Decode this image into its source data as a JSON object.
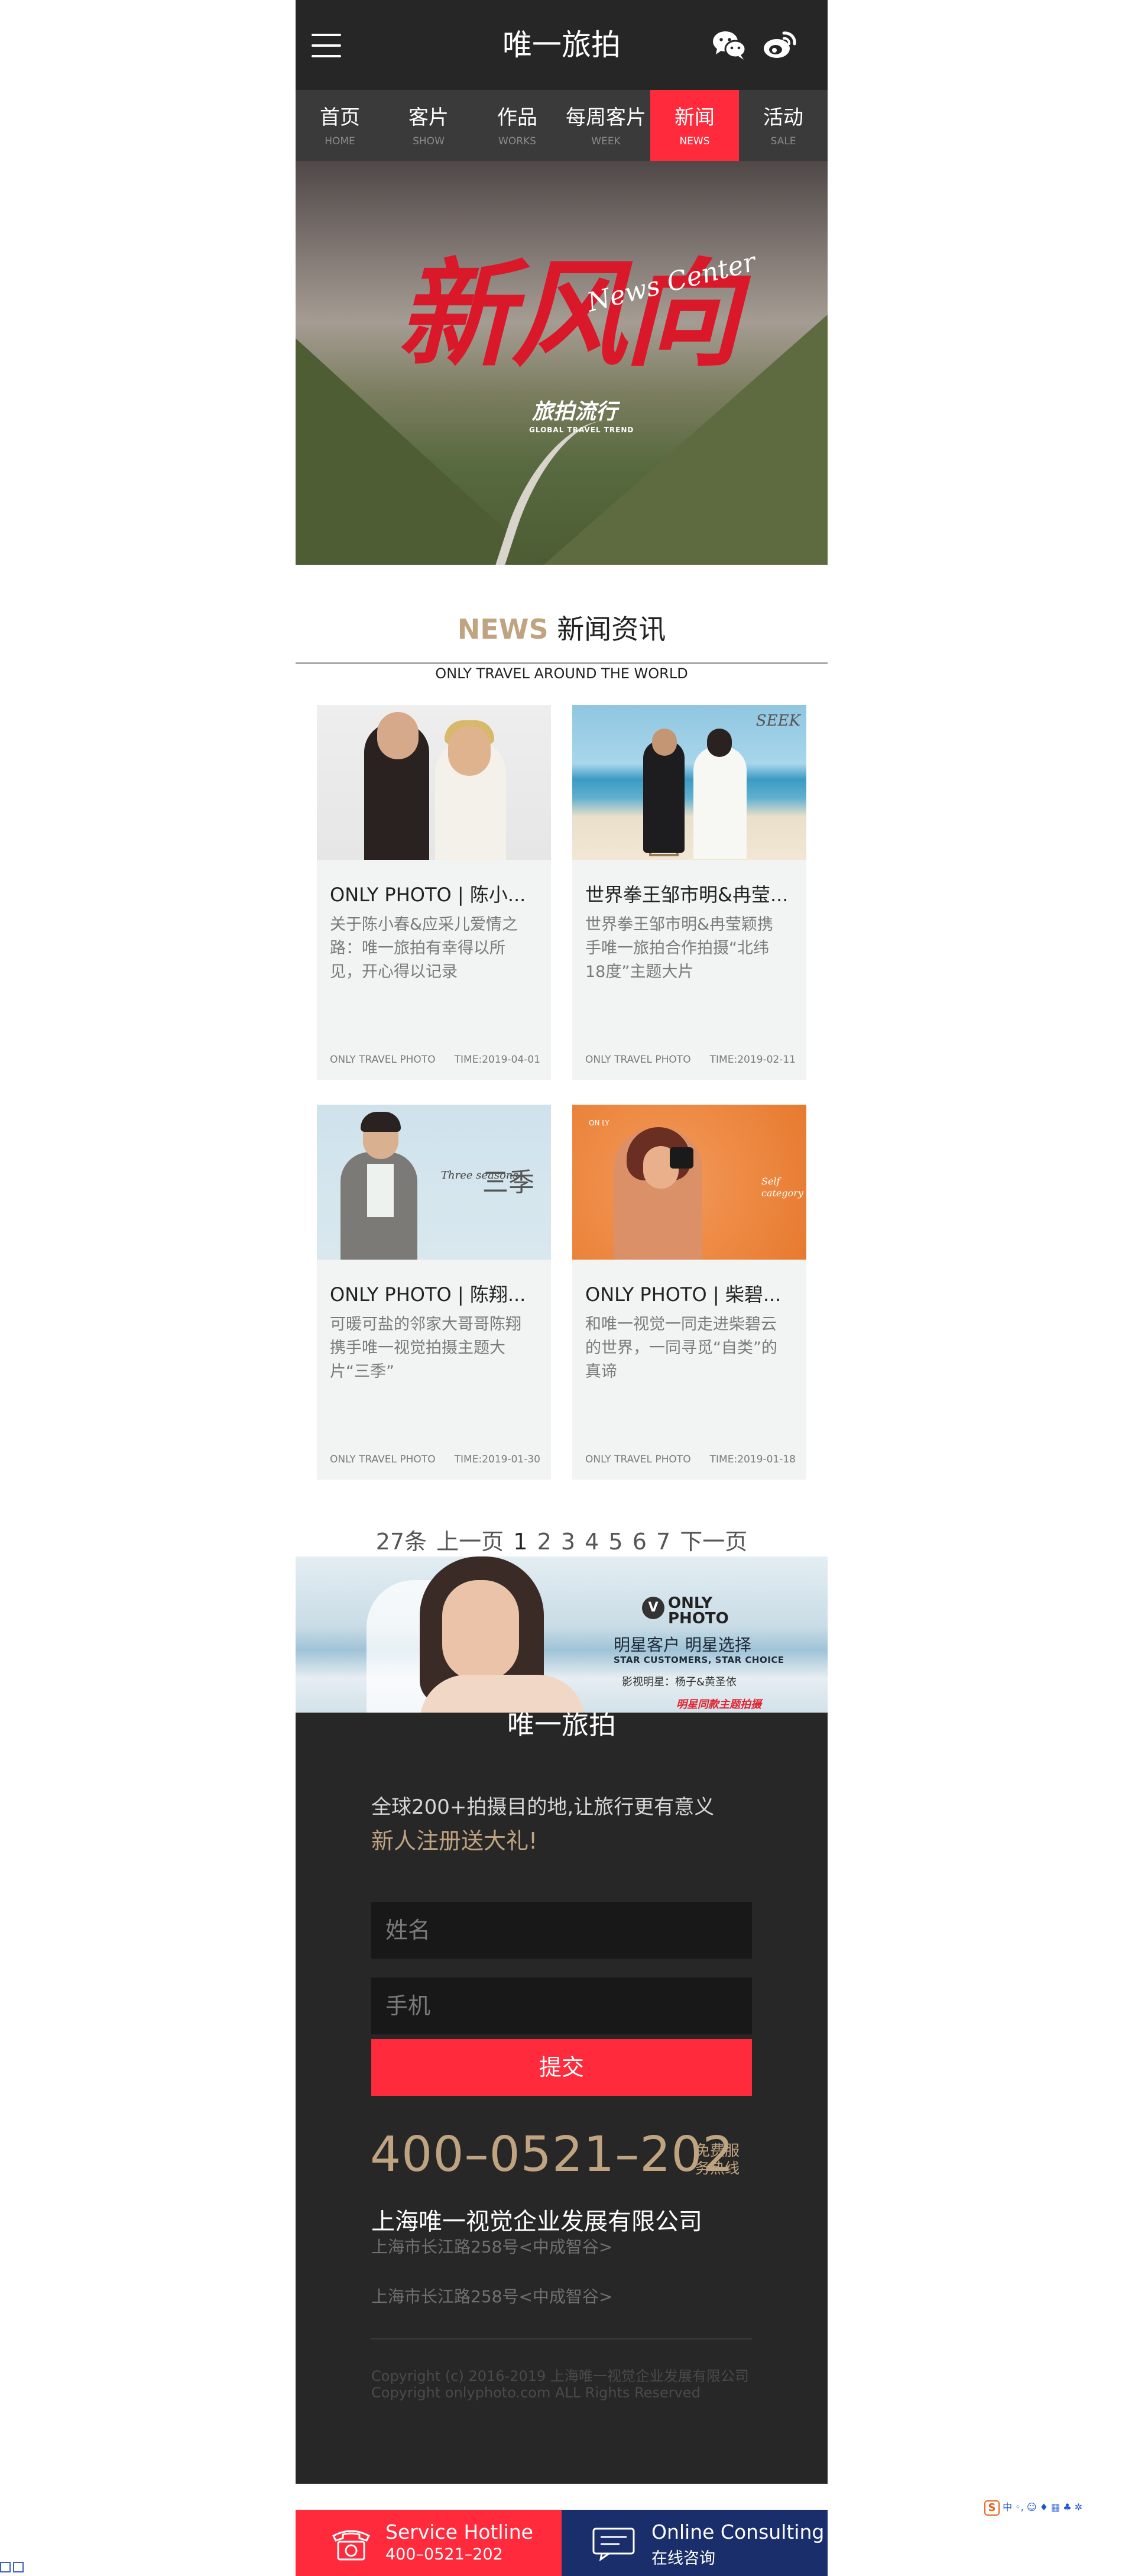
{
  "header": {
    "title": "唯一旅拍",
    "icons": [
      "menu-icon",
      "wechat-icon",
      "weibo-icon"
    ]
  },
  "nav": [
    {
      "cn": "首页",
      "en": "HOME",
      "active": false
    },
    {
      "cn": "客片",
      "en": "SHOW",
      "active": false
    },
    {
      "cn": "作品",
      "en": "WORKS",
      "active": false
    },
    {
      "cn": "每周客片",
      "en": "WEEK",
      "active": false
    },
    {
      "cn": "新闻",
      "en": "NEWS",
      "active": true
    },
    {
      "cn": "活动",
      "en": "SALE",
      "active": false
    }
  ],
  "banner": {
    "big_text": "新风向",
    "script_text": "News Center",
    "sub_text": "旅拍流行",
    "sub_en": "GLOBAL TRAVEL TREND"
  },
  "section": {
    "title_en": "NEWS",
    "title_cn": "新闻资讯",
    "subtitle": "ONLY TRAVEL AROUND THE WORLD"
  },
  "news": [
    {
      "title": "ONLY PHOTO | 陈小...",
      "desc": "关于陈小春&应采儿爱情之路：唯一旅拍有幸得以所见，开心得以记录",
      "source": "ONLY TRAVEL PHOTO",
      "time": "TIME:2019-04-01"
    },
    {
      "title": "世界拳王邹市明&冉莹...",
      "desc": "世界拳王邹市明&冉莹颖携手唯一旅拍合作拍摄“北纬18度”主题大片",
      "source": "ONLY TRAVEL PHOTO",
      "time": "TIME:2019-02-11",
      "image_logo": "SEEK"
    },
    {
      "title": "ONLY PHOTO | 陈翔...",
      "desc": "可暖可盐的邻家大哥哥陈翔携手唯一视觉拍摄主题大片“三季”",
      "source": "ONLY TRAVEL PHOTO",
      "time": "TIME:2019-01-30",
      "image_cn": "三季",
      "image_script": "Three seasons"
    },
    {
      "title": "ONLY PHOTO | 柴碧...",
      "desc": "和唯一视觉一同走进柴碧云的世界，一同寻觅“自类”的真谛",
      "source": "ONLY TRAVEL PHOTO",
      "time": "TIME:2019-01-18",
      "image_script": "Self category",
      "image_mark": "ON LY"
    }
  ],
  "pagination": {
    "total": "27条",
    "prev": "上一页",
    "pages": [
      "1",
      "2",
      "3",
      "4",
      "5",
      "6",
      "7"
    ],
    "current": "1",
    "next": "下一页"
  },
  "ad": {
    "logo_letter": "V",
    "brand_line1": "ONLY",
    "brand_line2": "PHOTO",
    "line1": "明星客户  明星选择",
    "line2": "STAR CUSTOMERS, STAR CHOICE",
    "line3": "影视明星：杨子&黄圣依",
    "line4": "明星同款主题拍摄"
  },
  "footer": {
    "title": "唯一旅拍",
    "line1": "全球200+拍摄目的地,让旅行更有意义",
    "line2": "新人注册送大礼!",
    "name_placeholder": "姓名",
    "phone_placeholder": "手机",
    "submit": "提交",
    "hotline": "400–0521–202",
    "hotline_tag": "免费服务热线",
    "company": "上海唯一视觉企业发展有限公司",
    "address1": "上海市长江路258号<中成智谷>",
    "address2": "上海市长江路258号<中成智谷>",
    "copyright1": "Copyright (c) 2016-2019 上海唯一视觉企业发展有限公司",
    "copyright2": "Copyright onlyphoto.com ALL Rights Reserved"
  },
  "bottom_bar": {
    "hotline_title": "Service Hotline",
    "hotline_number": "400–0521–202",
    "consult_title": "Online Consulting",
    "consult_sub": "在线咨询"
  },
  "ime": {
    "logo": "S",
    "label": "中"
  },
  "colors": {
    "accent_red": "#ff2a3c",
    "gold": "#c0a481",
    "dark": "#262626",
    "navy": "#1b2e6c"
  }
}
